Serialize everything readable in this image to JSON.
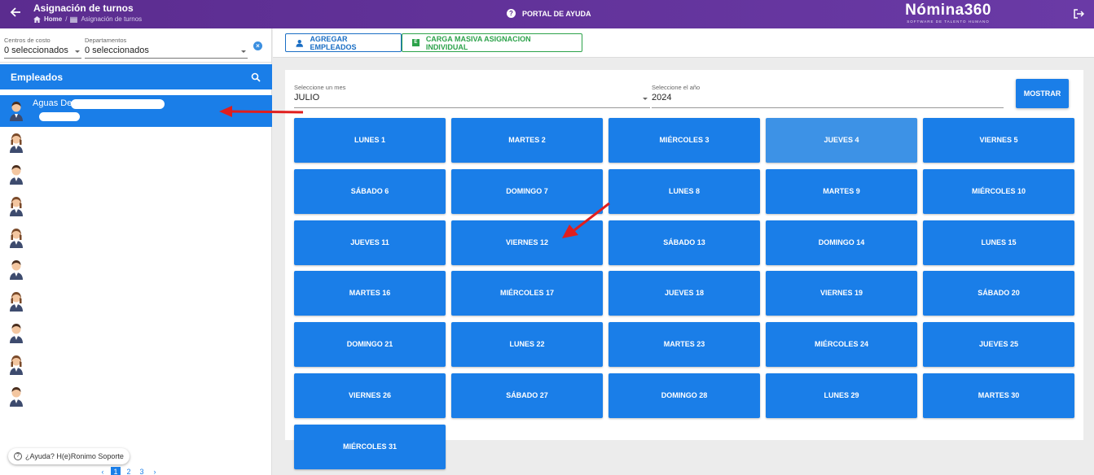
{
  "header": {
    "title": "Asignación de turnos",
    "breadcrumb_home": "Home",
    "breadcrumb_current": "Asignación de turnos",
    "portal_label": "PORTAL DE AYUDA",
    "brand_name": "Nómina360",
    "brand_tagline": "SOFTWARE DE TALENTO HUMANO"
  },
  "filters": {
    "cost_centers_label": "Centros de costo",
    "cost_centers_value": "0 seleccionados",
    "departments_label": "Departamentos",
    "departments_value": "0 seleccionados"
  },
  "employees": {
    "header": "Empleados",
    "selected_name": "Aguas De",
    "count": 10
  },
  "help_chip": "¿Ayuda? H(e)Ronimo Soporte",
  "pagination": {
    "prev": "‹",
    "pages": [
      "1",
      "2",
      "3"
    ],
    "current": "1",
    "next": "›"
  },
  "toolbar": {
    "add_employees": "AGREGAR EMPLEADOS",
    "bulk_load": "CARGA MASIVA ASIGNACION INDIVIDUAL"
  },
  "selectors": {
    "month_label": "Seleccione un mes",
    "month_value": "JULIO",
    "year_label": "Seleccione el año",
    "year_value": "2024",
    "show_button": "MOSTRAR"
  },
  "days": [
    "LUNES 1",
    "MARTES 2",
    "MIÉRCOLES 3",
    "JUEVES 4",
    "VIERNES 5",
    "SÁBADO 6",
    "DOMINGO 7",
    "LUNES 8",
    "MARTES 9",
    "MIÉRCOLES 10",
    "JUEVES 11",
    "VIERNES 12",
    "SÁBADO 13",
    "DOMINGO 14",
    "LUNES 15",
    "MARTES 16",
    "MIÉRCOLES 17",
    "JUEVES 18",
    "VIERNES 19",
    "SÁBADO 20",
    "DOMINGO 21",
    "LUNES 22",
    "MARTES 23",
    "MIÉRCOLES 24",
    "JUEVES 25",
    "VIERNES 26",
    "SÁBADO 27",
    "DOMINGO 28",
    "LUNES 29",
    "MARTES 30",
    "MIÉRCOLES 31"
  ],
  "highlighted_day": "JUEVES 4",
  "colors": {
    "topbar": "#5b2c8f",
    "primary": "#1a7ee8",
    "green": "#2ca24a",
    "annotation_arrow": "#e01e1e"
  }
}
